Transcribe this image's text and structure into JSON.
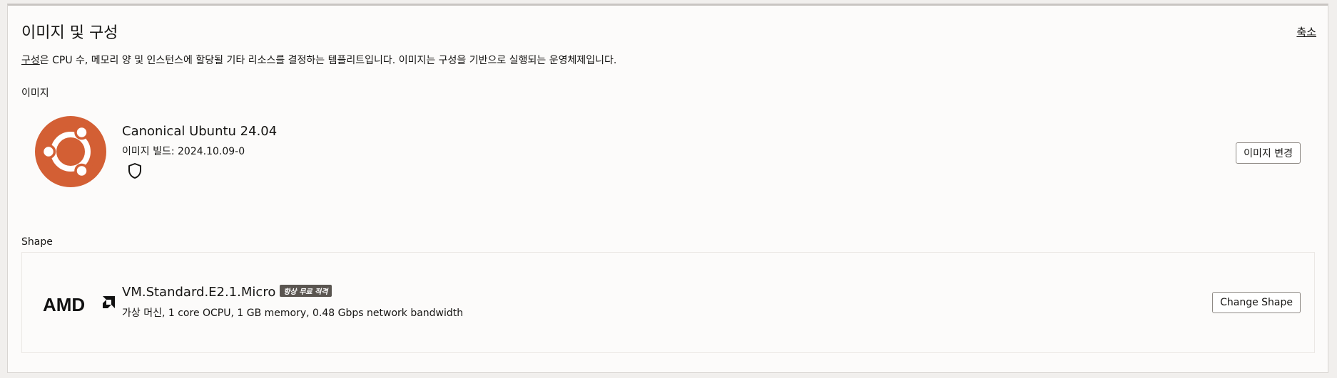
{
  "section": {
    "title": "이미지 및 구성",
    "collapse_label": "축소",
    "description_link": "구성",
    "description_rest": "은 CPU 수, 메모리 양 및 인스턴스에 할당될 기타 리소스를 결정하는 템플리트입니다. 이미지는 구성을 기반으로 실행되는 운영체제입니다."
  },
  "image": {
    "label": "이미지",
    "name": "Canonical Ubuntu 24.04",
    "build": "이미지 빌드: 2024.10.09-0",
    "logo_icon": "ubuntu-logo",
    "badge_icon": "shield-icon",
    "change_button": "이미지 변경"
  },
  "shape": {
    "label": "Shape",
    "name": "VM.Standard.E2.1.Micro",
    "badge": "항상 무료 적격",
    "spec": "가상 머신, 1 core OCPU, 1 GB memory, 0.48 Gbps network bandwidth",
    "logo_icon": "amd-logo",
    "change_button": "Change Shape"
  },
  "colors": {
    "ubuntu_orange": "#d35f34",
    "badge_bg": "#5a5550",
    "panel_bg": "#fcfbfa"
  }
}
